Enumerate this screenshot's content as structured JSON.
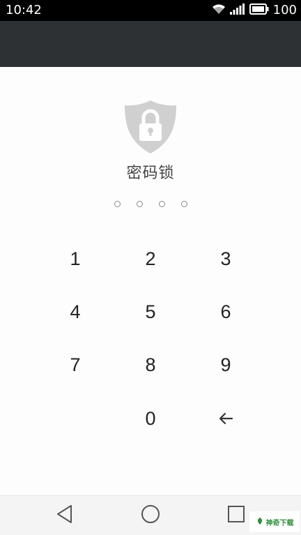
{
  "status_bar": {
    "time": "10:42",
    "battery_text": "100",
    "icons": [
      "wifi-icon",
      "signal-icon",
      "battery-icon"
    ]
  },
  "lock": {
    "icon": "shield-lock-icon",
    "title": "密码锁",
    "pin_length": 4,
    "entered_digits": 0
  },
  "keypad": {
    "keys": [
      "1",
      "2",
      "3",
      "4",
      "5",
      "6",
      "7",
      "8",
      "9",
      "0"
    ],
    "backspace_icon": "backspace-arrow-icon"
  },
  "nav_bar": {
    "buttons": [
      "back-icon",
      "home-icon",
      "recents-icon"
    ]
  },
  "watermark": {
    "text": "神奇下载"
  },
  "colors": {
    "status_bar": "#000000",
    "header": "#2e3133",
    "background": "#fdfdfd",
    "shield": "#d0d0d0",
    "text": "#222222"
  }
}
